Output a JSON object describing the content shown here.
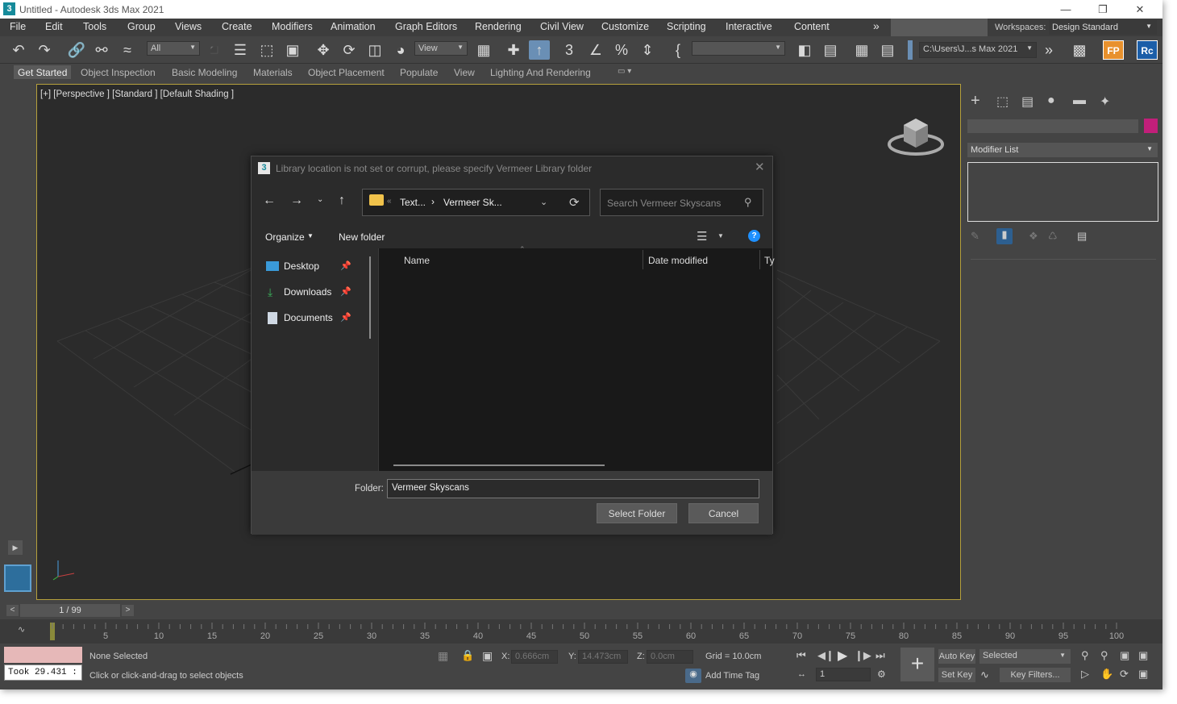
{
  "window": {
    "title": "Untitled - Autodesk 3ds Max 2021",
    "app_icon": "3"
  },
  "menu": [
    "File",
    "Edit",
    "Tools",
    "Group",
    "Views",
    "Create",
    "Modifiers",
    "Animation",
    "Graph Editors",
    "Rendering",
    "Civil View",
    "Customize",
    "Scripting",
    "Interactive",
    "Content"
  ],
  "workspaces": {
    "label": "Workspaces:",
    "value": "Design Standard"
  },
  "toolbar": {
    "filter": "All",
    "refcoord": "View",
    "project_path": "C:\\Users\\J...s Max 2021",
    "fp": "FP",
    "rc": "Rc"
  },
  "ribbon_tabs": [
    "Get Started",
    "Object Inspection",
    "Basic Modeling",
    "Materials",
    "Object Placement",
    "Populate",
    "View",
    "Lighting And Rendering"
  ],
  "viewport": {
    "label": "[+] [Perspective ] [Standard ] [Default Shading ]"
  },
  "command_panel": {
    "modifier_list": "Modifier List"
  },
  "dialog": {
    "title": "Library location is not set or corrupt, please specify Vermeer Library folder",
    "breadcrumb": {
      "a": "Text...",
      "b": "Vermeer Sk..."
    },
    "search_placeholder": "Search Vermeer Skyscans",
    "organize": "Organize",
    "new_folder": "New folder",
    "nav": [
      {
        "label": "Desktop"
      },
      {
        "label": "Downloads"
      },
      {
        "label": "Documents"
      }
    ],
    "columns": {
      "name": "Name",
      "date": "Date modified",
      "type": "Ty"
    },
    "folder_label": "Folder:",
    "folder_value": "Vermeer Skyscans",
    "select_button": "Select Folder",
    "cancel_button": "Cancel"
  },
  "timeline": {
    "frame": "1 / 99",
    "ticks": [
      "5",
      "10",
      "15",
      "20",
      "25",
      "30",
      "35",
      "40",
      "45",
      "50",
      "55",
      "60",
      "65",
      "70",
      "75",
      "80",
      "85",
      "90",
      "95",
      "100"
    ]
  },
  "status": {
    "took": "Took 29.431 :",
    "selection": "None Selected",
    "prompt": "Click or click-and-drag to select objects",
    "x_label": "X:",
    "x": "0.666cm",
    "y_label": "Y:",
    "y": "14.473cm",
    "z_label": "Z:",
    "z": "0.0cm",
    "grid": "Grid = 10.0cm",
    "add_time_tag": "Add Time Tag",
    "frame": "1",
    "auto_key": "Auto Key",
    "set_key": "Set Key",
    "selected": "Selected",
    "key_filters": "Key Filters..."
  },
  "colors": {
    "viewport_border": "#b5a03c",
    "accent": "#1e90ff",
    "swatch": "#c21f7a"
  }
}
